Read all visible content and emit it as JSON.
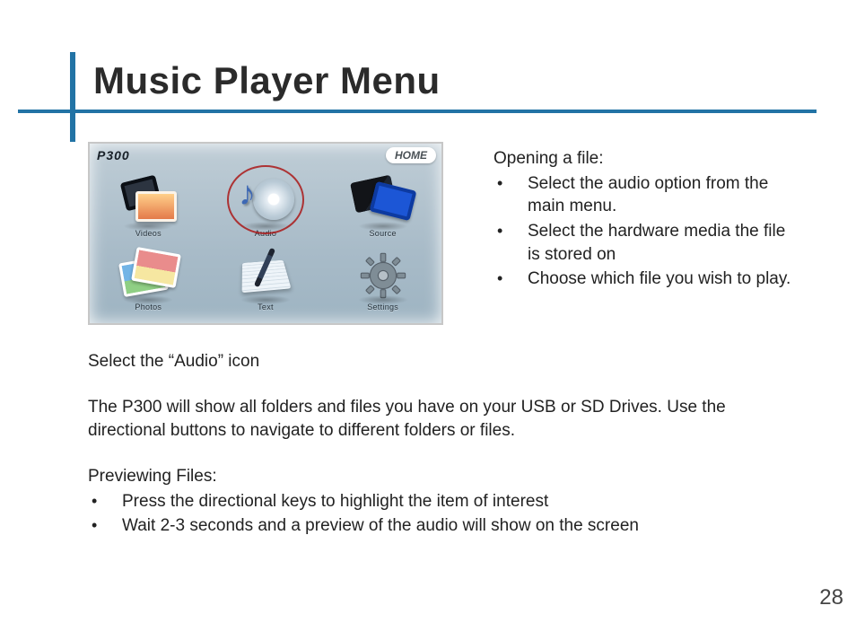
{
  "title": "Music Player Menu",
  "device": {
    "brand": "P300",
    "home_label": "HOME",
    "tiles": [
      {
        "name": "videos-icon",
        "label": "Videos"
      },
      {
        "name": "audio-icon",
        "label": "Audio",
        "selected": true
      },
      {
        "name": "source-icon",
        "label": "Source"
      },
      {
        "name": "photos-icon",
        "label": "Photos"
      },
      {
        "name": "text-icon",
        "label": "Text"
      },
      {
        "name": "settings-icon",
        "label": "Settings"
      }
    ]
  },
  "opening": {
    "heading": "Opening a file:",
    "items": [
      "Select the audio option from the main menu.",
      "Select the hardware me­dia the file is stored on",
      "Choose which file you wish to play."
    ]
  },
  "body": {
    "select_line": "Select the “Audio” icon",
    "para": "The P300 will show all folders and files you have on your USB or SD Drives.  Use the directional buttons to navigate to different folders or files."
  },
  "preview": {
    "heading": "Previewing Files:",
    "items": [
      "Press the directional keys to highlight the item of interest",
      "Wait 2-3 seconds and a preview of the audio will show on the screen"
    ]
  },
  "page_number": "28"
}
